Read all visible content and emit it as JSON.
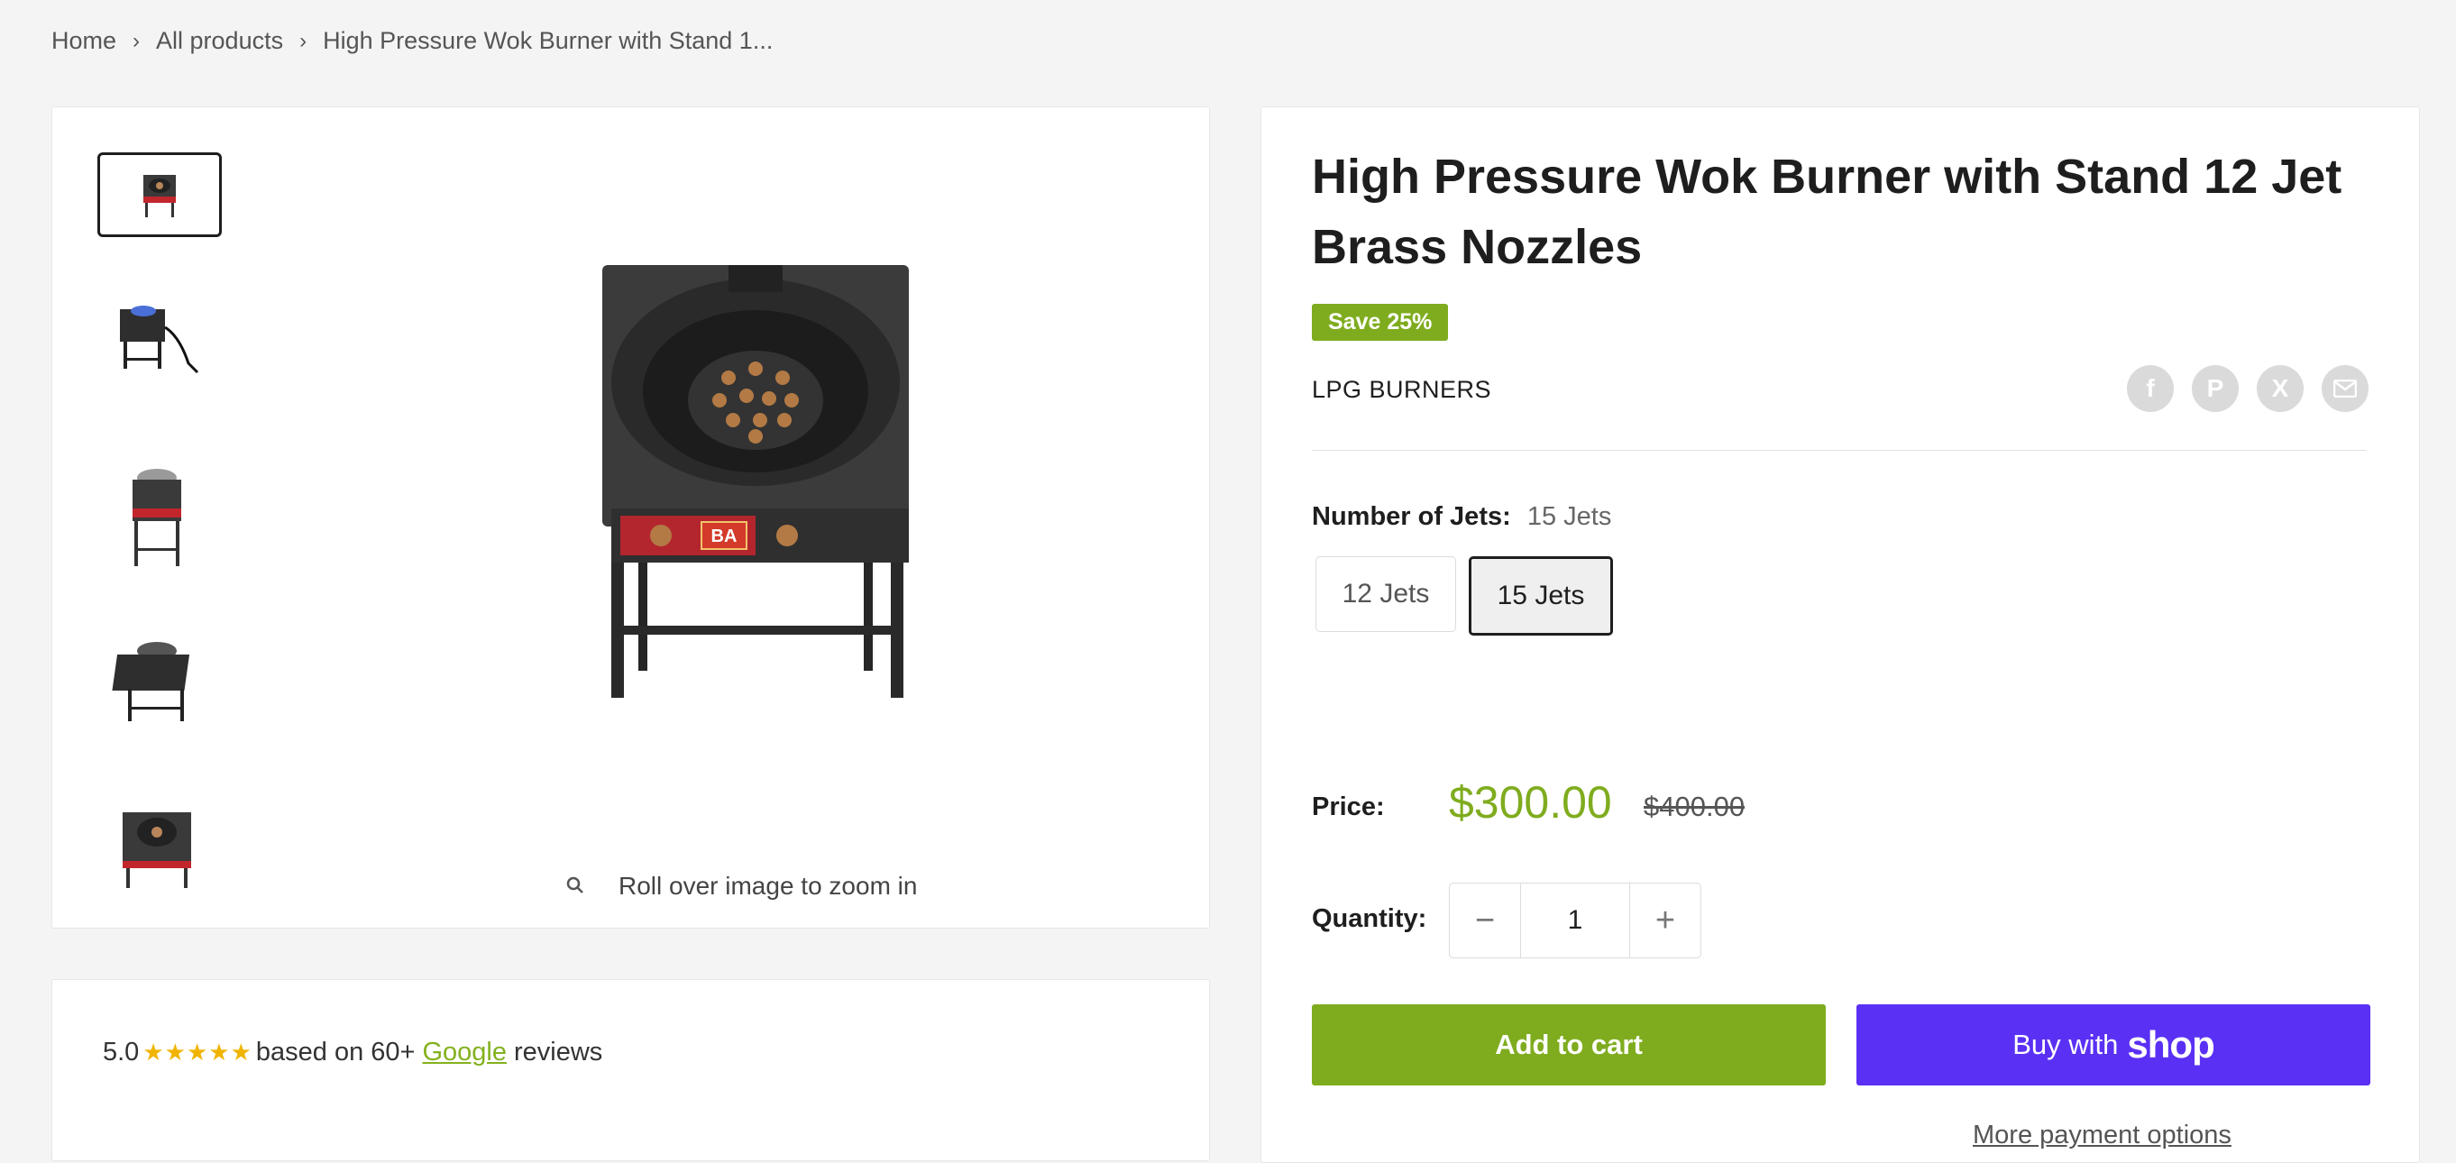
{
  "breadcrumb": {
    "items": [
      "Home",
      "All products",
      "High Pressure Wok Burner with Stand 1..."
    ]
  },
  "gallery": {
    "zoom_hint": "Roll over image to zoom in",
    "main_image_text": "BA"
  },
  "reviews": {
    "score": "5.0",
    "stars": "★★★★★",
    "prefix": "based on 60+",
    "link": "Google",
    "suffix": "reviews"
  },
  "product": {
    "title": "High Pressure Wok Burner with Stand 12 Jet Brass Nozzles",
    "save_badge": "Save 25%",
    "vendor": "LPG BURNERS",
    "option_label": "Number of Jets:",
    "option_value": "15 Jets",
    "variants": [
      "12 Jets",
      "15 Jets"
    ],
    "price_label": "Price:",
    "price_now": "$300.00",
    "price_was": "$400.00",
    "quantity_label": "Quantity:",
    "quantity": "1",
    "add_to_cart": "Add to cart",
    "buy_with": "Buy with",
    "shop_word": "shop",
    "more_payment": "More payment options"
  },
  "share_icons": [
    "facebook-icon",
    "pinterest-icon",
    "x-icon",
    "email-icon"
  ],
  "colors": {
    "accent_green": "#7fac1e",
    "shop_purple": "#5a31f4",
    "star": "#f0b400"
  }
}
